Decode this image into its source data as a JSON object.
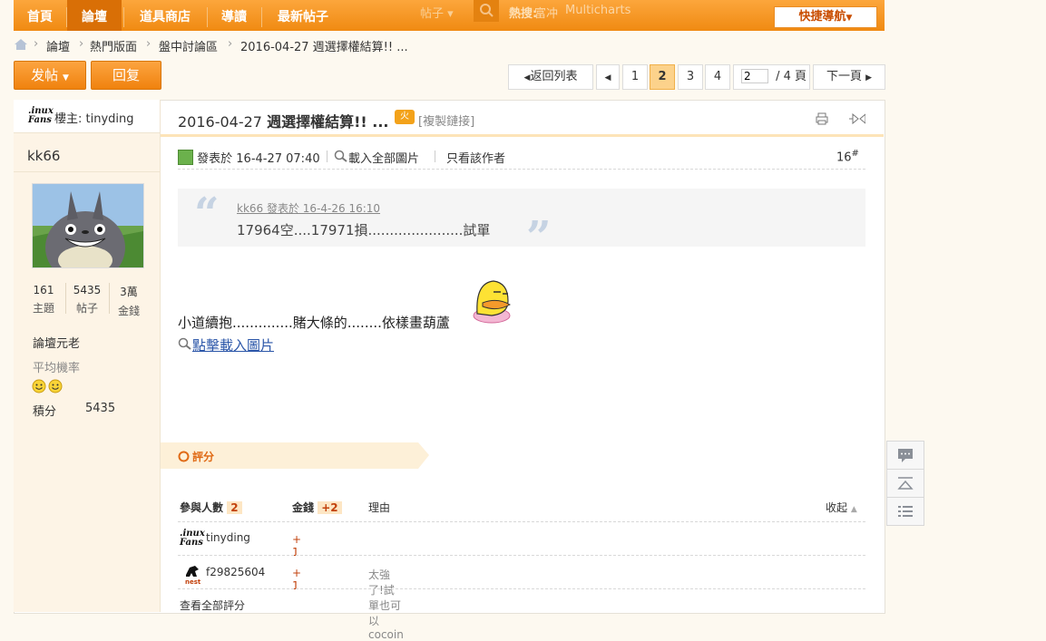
{
  "nav": {
    "items": [
      "首頁",
      "論壇",
      "道具商店",
      "導讀",
      "最新帖子"
    ],
    "active_index": 1,
    "search_type": "帖子",
    "hot_label": "熱搜:",
    "hot_items": [
      "富冲",
      "Multicharts"
    ],
    "quick_nav": "快捷導航"
  },
  "breadcrumb": [
    "論壇",
    "熱門版面",
    "盤中討論區",
    "2016-04-27 週選擇權結算!! ..."
  ],
  "actions": {
    "post": "发帖",
    "reply": "回复"
  },
  "pager": {
    "back": "返回列表",
    "pages": [
      "1",
      "2",
      "3",
      "4"
    ],
    "current": "2",
    "input_value": "2",
    "total": "/ 4 頁",
    "next": "下一頁"
  },
  "author": {
    "logo_top": ".inux",
    "logo_bottom": "Fans",
    "owner_label": "樓主: tinyding",
    "name": "kk66",
    "stats": [
      {
        "value": "161",
        "label": "主題"
      },
      {
        "value": "5435",
        "label": "帖子"
      },
      {
        "value": "3萬",
        "label": "金錢"
      }
    ],
    "rank": "論壇元老",
    "prob_label": "平均機率",
    "points_label": "積分",
    "points_value": "5435"
  },
  "post": {
    "title_date": "2016-04-27",
    "title_text": "週選擇權結算!! ...",
    "hot_badge": "火",
    "copy_link": "[複製鏈接]",
    "posted": "發表於 16-4-27 07:40",
    "load_all": "載入全部圖片",
    "only_author": "只看該作者",
    "floor_num": "16",
    "floor_sup": "#",
    "quote_author": "kk66 發表於 16-4-26 16:10",
    "quote_text": "17964空....17971損......................試單",
    "body": "小道續抱..............賭大條的........依樣畫葫蘆",
    "load_image": "點擊載入圖片"
  },
  "rating": {
    "title": "評分",
    "col_people": "參與人數",
    "people_count": "2",
    "col_money": "金錢",
    "money_total": "+2",
    "col_reason": "理由",
    "collapse": "收起",
    "rows": [
      {
        "user": "tinyding",
        "money": "+ 1",
        "reason": ""
      },
      {
        "user": "f29825604",
        "money": "+ 1",
        "reason": "太強了!試單也可以cocoin"
      }
    ],
    "rater_logo_caption": "nest",
    "view_all": "查看全部評分"
  },
  "colors": {
    "nav_orange": "#f08a12",
    "accent_red": "#c2410c"
  }
}
